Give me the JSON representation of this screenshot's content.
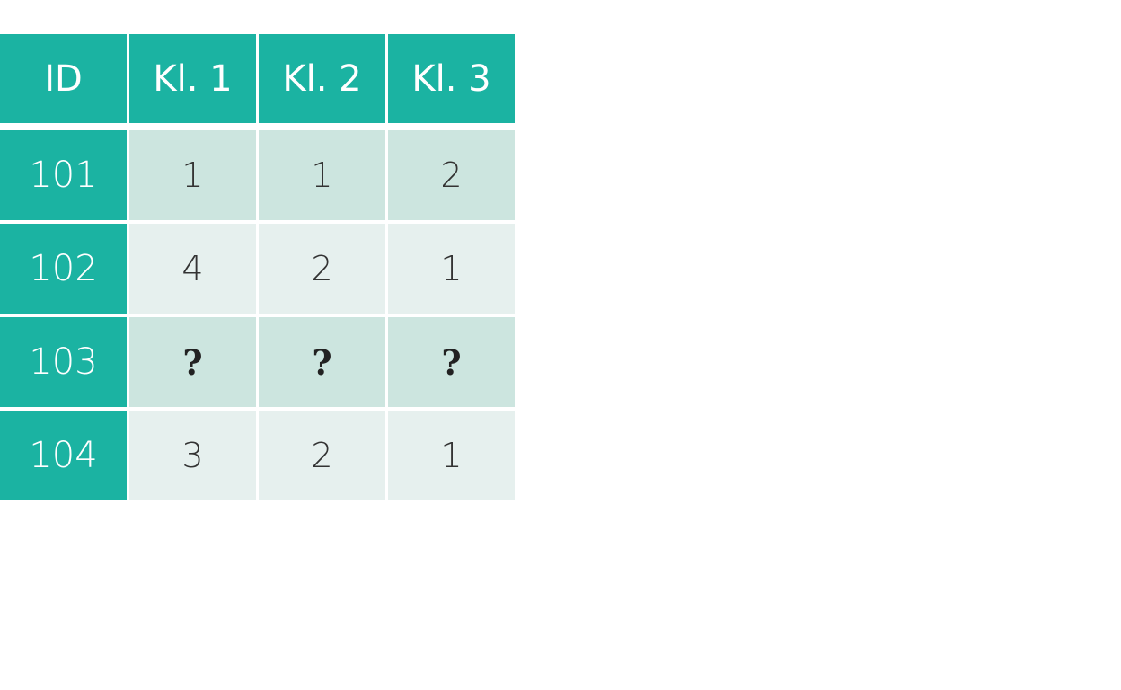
{
  "table": {
    "headers": [
      "ID",
      "Kl. 1",
      "Kl. 2",
      "Kl. 3"
    ],
    "rows": [
      {
        "id": "101",
        "values": [
          "1",
          "1",
          "2"
        ]
      },
      {
        "id": "102",
        "values": [
          "4",
          "2",
          "1"
        ]
      },
      {
        "id": "103",
        "values": [
          "?",
          "?",
          "?"
        ]
      },
      {
        "id": "104",
        "values": [
          "3",
          "2",
          "1"
        ]
      }
    ]
  },
  "colors": {
    "header_bg": "#1bb3a2",
    "row_dark": "#cce5df",
    "row_light": "#e6f0ee"
  }
}
